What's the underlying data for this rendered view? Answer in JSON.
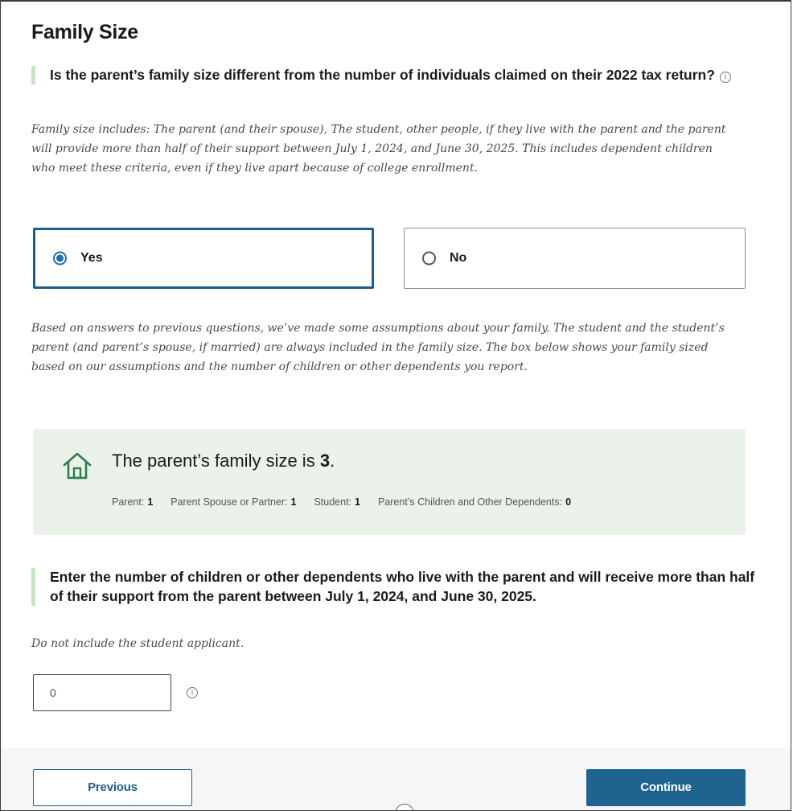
{
  "page": {
    "title": "Family Size"
  },
  "question1": {
    "text": "Is the parent’s family size different from the number of individuals claimed on their 2022 tax return?",
    "info_icon": "info-circle-icon",
    "helper": "Family size includes: The parent (and their spouse), The student, other people, if they live with the parent and the parent will provide more than half of their support between July 1, 2024, and June 30, 2025. This includes dependent children who meet these criteria, even if they live apart because of college enrollment.",
    "options": [
      {
        "label": "Yes",
        "selected": true
      },
      {
        "label": "No",
        "selected": false
      }
    ]
  },
  "assumptions_text": "Based on answers to previous questions, we’ve made some assumptions about your family. The student and the student’s parent (and parent’s spouse, if married) are always included in the family size. The box below shows your family sized based on our assumptions and the number of children or other dependents you report.",
  "summary": {
    "icon": "house-icon",
    "text_prefix": "The parent’s family size is",
    "size_value": "3",
    "text_suffix": ".",
    "details": [
      {
        "label": "Parent:",
        "value": "1"
      },
      {
        "label": "Parent Spouse or Partner:",
        "value": "1"
      },
      {
        "label": "Student:",
        "value": "1"
      },
      {
        "label": "Parent’s Children and Other Dependents:",
        "value": "0"
      }
    ]
  },
  "question2": {
    "text": "Enter the number of children or other dependents who live with the parent and will receive more than half of their support from the parent between July 1, 2024, and June 30, 2025.",
    "helper": "Do not include the student applicant.",
    "input_value": "0",
    "info_icon": "info-circle-icon"
  },
  "footer": {
    "previous_label": "Previous",
    "continue_label": "Continue"
  },
  "colors": {
    "primary": "#1f6491",
    "accent_bar": "#c7e5c0",
    "summary_bg": "#eaf2ea",
    "house_icon": "#2e7d4f"
  }
}
